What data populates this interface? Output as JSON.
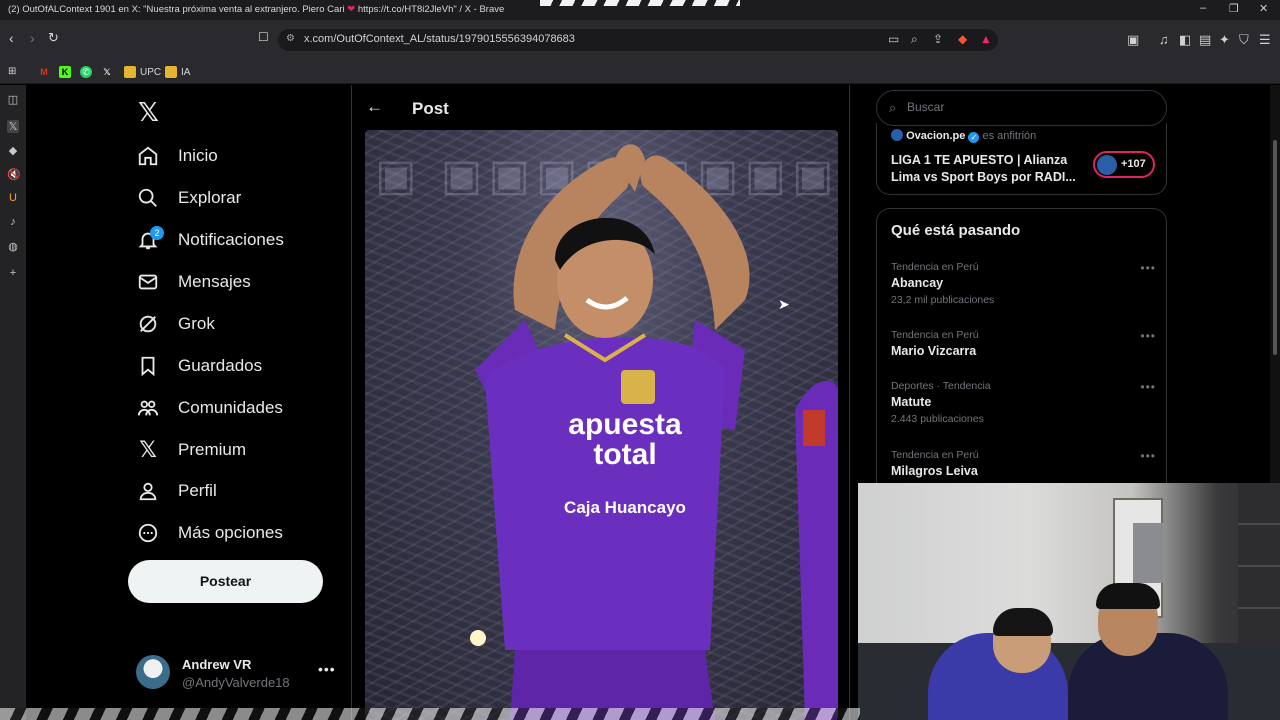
{
  "window": {
    "title_prefix": "(2) OutOfALContext 1901 en X: \"Nuestra próxima venta al extranjero. Piero Cari",
    "title_suffix": "https://t.co/HT8i2JleVh\" / X - Brave"
  },
  "browser": {
    "url": "x.com/OutOfContext_AL/status/1979015556394078683",
    "bookmarks": [
      {
        "label": "",
        "icon": "gmail-icon",
        "color": "#d93025"
      },
      {
        "label": "",
        "icon": "kick-icon",
        "color": "#53fc18"
      },
      {
        "label": "",
        "icon": "whatsapp-icon",
        "color": "#25d366"
      },
      {
        "label": "",
        "icon": "x-icon",
        "color": "#ffffff"
      },
      {
        "label": "UPC",
        "icon": "folder-icon",
        "color": "#e5b432"
      },
      {
        "label": "IA",
        "icon": "folder-icon",
        "color": "#e5b432"
      }
    ]
  },
  "nav": {
    "items": [
      {
        "label": "Inicio",
        "icon": "home-icon"
      },
      {
        "label": "Explorar",
        "icon": "search-icon"
      },
      {
        "label": "Notificaciones",
        "icon": "bell-icon",
        "badge": "2"
      },
      {
        "label": "Mensajes",
        "icon": "mail-icon"
      },
      {
        "label": "Grok",
        "icon": "grok-icon"
      },
      {
        "label": "Guardados",
        "icon": "bookmark-icon"
      },
      {
        "label": "Comunidades",
        "icon": "communities-icon"
      },
      {
        "label": "Premium",
        "icon": "x-icon"
      },
      {
        "label": "Perfil",
        "icon": "person-icon"
      },
      {
        "label": "Más opciones",
        "icon": "more-circle-icon"
      }
    ],
    "post_button": "Postear",
    "account": {
      "name": "Andrew VR",
      "handle": "@AndyValverde18"
    }
  },
  "post": {
    "header": "Post",
    "image": {
      "jersey_sponsor_1": "apuesta total",
      "jersey_sponsor_2": "Caja Huancayo"
    }
  },
  "sidebar": {
    "search_placeholder": "Buscar",
    "space": {
      "host": "Ovacion.pe",
      "host_suffix": "es anfitrión",
      "title": "LIGA 1 TE APUESTO | Alianza Lima vs Sport Boys por RADI...",
      "listeners": "+107"
    },
    "trends_title": "Qué está pasando",
    "trends": [
      {
        "context": "Tendencia en Perú",
        "name": "Abancay",
        "count": "23,2 mil publicaciones"
      },
      {
        "context": "Tendencia en Perú",
        "name": "Mario Vizcarra",
        "count": ""
      },
      {
        "context": "Deportes · Tendencia",
        "name": "Matute",
        "count": "2.443 publicaciones"
      },
      {
        "context": "Tendencia en Perú",
        "name": "Milagros Leiva",
        "count": ""
      }
    ]
  },
  "colors": {
    "accent": "#1d9bf0",
    "brand_purple": "#6a2bb8",
    "live_red": "#e0245e"
  }
}
